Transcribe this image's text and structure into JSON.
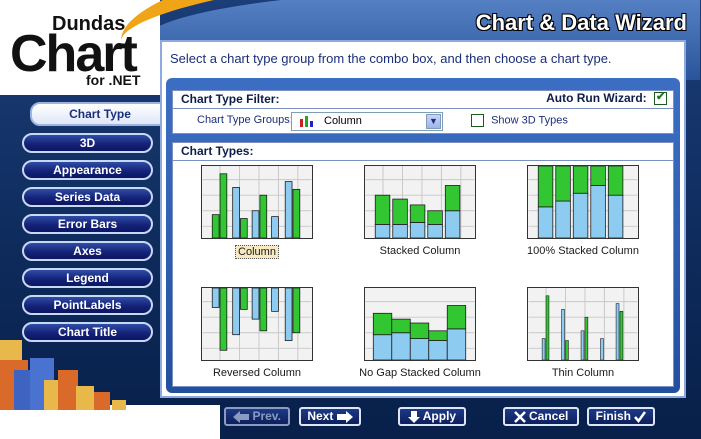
{
  "logo": {
    "brand": "Dundas",
    "product": "Chart",
    "platform": "for .NET"
  },
  "window_title": "Chart & Data Wizard",
  "nav": [
    {
      "label": "Chart Type",
      "active": true
    },
    {
      "label": "3D"
    },
    {
      "label": "Appearance"
    },
    {
      "label": "Series Data"
    },
    {
      "label": "Error Bars"
    },
    {
      "label": "Axes"
    },
    {
      "label": "Legend"
    },
    {
      "label": "PointLabels"
    },
    {
      "label": "Chart Title"
    }
  ],
  "instruction": "Select a chart type group from the combo box, and then choose a chart type.",
  "filter": {
    "title": "Chart Type Filter:",
    "auto_run_label": "Auto Run Wizard:",
    "auto_run_checked": true,
    "groups_label": "Chart Type Groups:",
    "groups_value": "Column",
    "show3d_label": "Show 3D Types",
    "show3d_checked": false
  },
  "types": {
    "title": "Chart Types:",
    "items": [
      {
        "label": "Column",
        "selected": true
      },
      {
        "label": "Stacked Column"
      },
      {
        "label": "100% Stacked Column"
      },
      {
        "label": "Reversed Column"
      },
      {
        "label": "No Gap Stacked Column"
      },
      {
        "label": "Thin Column"
      }
    ]
  },
  "buttons": {
    "prev": "Prev.",
    "next": "Next",
    "apply": "Apply",
    "cancel": "Cancel",
    "finish": "Finish"
  },
  "colors": {
    "green": "#33c633",
    "blue": "#8ecbf0",
    "navy": "#0d2a5a",
    "accent": "#f0a418"
  }
}
